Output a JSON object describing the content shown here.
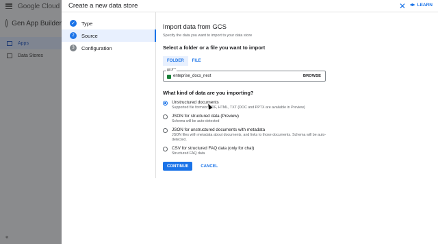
{
  "shell": {
    "brand": "Google Cloud",
    "product": "Gen App Builder",
    "nav": [
      {
        "label": "Apps",
        "icon": "apps-icon",
        "active": true
      },
      {
        "label": "Data Stores",
        "icon": "database-icon",
        "active": false
      }
    ],
    "collapse_icon": "collapse-left-icon"
  },
  "panel": {
    "title": "Create a new data store",
    "learn_label": "LEARN",
    "close_icon": "close-icon"
  },
  "steps": [
    {
      "num": "",
      "label": "Type",
      "state": "done"
    },
    {
      "num": "2",
      "label": "Source",
      "state": "active"
    },
    {
      "num": "3",
      "label": "Configuration",
      "state": "pending"
    }
  ],
  "form": {
    "heading": "Import data from GCS",
    "subheading": "Specify the data you want to import to your data store",
    "select_heading": "Select a folder or a file you want to import",
    "toggle": {
      "folder": "FOLDER",
      "file": "FILE",
      "selected": "FOLDER"
    },
    "gs_field": {
      "label": "gs:// *",
      "value": "enteprise_docs_next",
      "browse": "BROWSE"
    },
    "kind_heading": "What kind of data are you importing?",
    "options": [
      {
        "title": "Unstructured documents",
        "desc": "Supported file formats: PDF, HTML, TXT (DOC and PPTX are available in Preview)",
        "selected": true
      },
      {
        "title": "JSON for structured data (Preview)",
        "desc": "Schema will be auto-detected",
        "selected": false
      },
      {
        "title": "JSON for unstructured documents with metadata",
        "desc": "JSON files with metadata about documents, and links to those documents. Schema will be auto-detected.",
        "selected": false
      },
      {
        "title": "CSV for structured FAQ data (only for chat)",
        "desc": "Structured FAQ data",
        "selected": false
      }
    ],
    "continue_label": "CONTINUE",
    "cancel_label": "CANCEL"
  },
  "colors": {
    "accent": "#1a73e8",
    "shell_overlay": "#8a8b8d"
  }
}
